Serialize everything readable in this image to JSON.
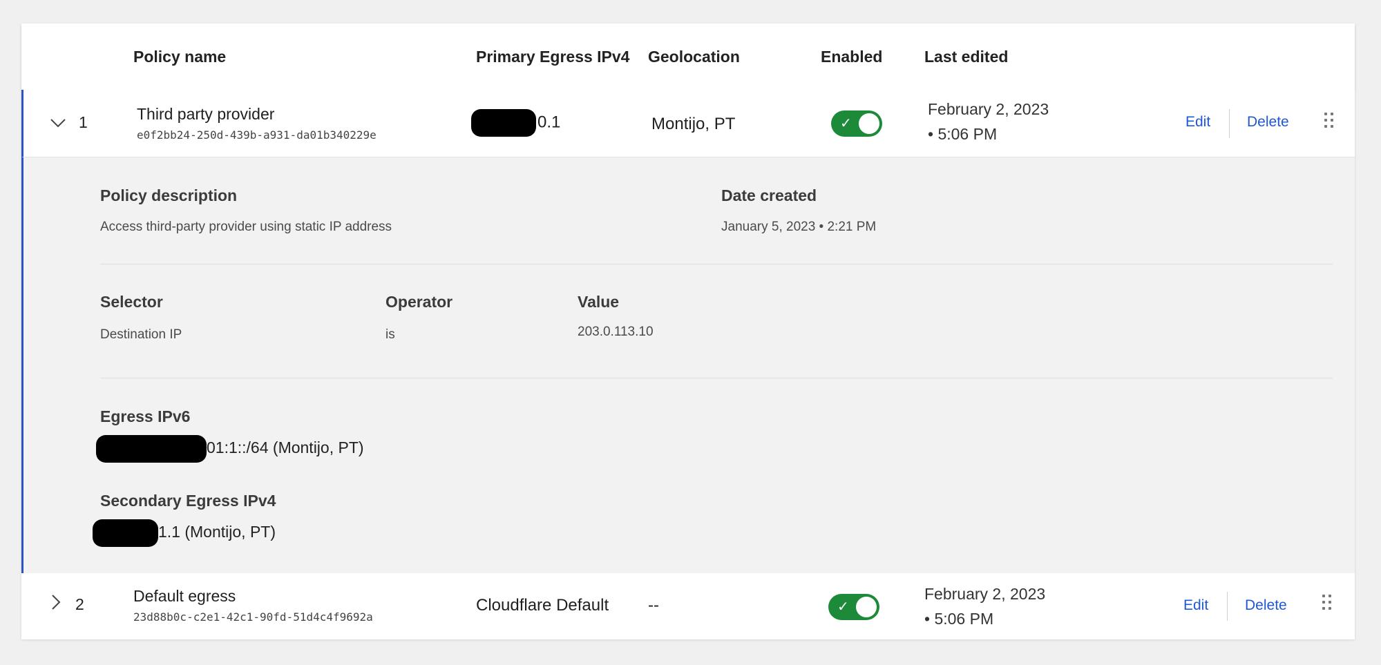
{
  "columns": {
    "policy_name": "Policy name",
    "primary_egress": "Primary Egress IPv4",
    "geolocation": "Geolocation",
    "enabled": "Enabled",
    "last_edited": "Last edited"
  },
  "rows": [
    {
      "index": "1",
      "expanded": true,
      "name": "Third party provider",
      "id": "e0f2bb24-250d-439b-a931-da01b340229e",
      "primary_egress_suffix": "0.1",
      "geolocation": "Montijo, PT",
      "enabled": true,
      "last_edited_date": "February 2, 2023",
      "last_edited_time": "• 5:06 PM",
      "edit_label": "Edit",
      "delete_label": "Delete"
    },
    {
      "index": "2",
      "expanded": false,
      "name": "Default egress",
      "id": "23d88b0c-c2e1-42c1-90fd-51d4c4f9692a",
      "primary_egress": "Cloudflare Default",
      "geolocation": "--",
      "enabled": true,
      "last_edited_date": "February 2, 2023",
      "last_edited_time": "• 5:06 PM",
      "edit_label": "Edit",
      "delete_label": "Delete"
    }
  ],
  "detail": {
    "policy_description_label": "Policy description",
    "policy_description": "Access third-party provider using static IP address",
    "date_created_label": "Date created",
    "date_created": "January 5, 2023 • 2:21 PM",
    "selector_label": "Selector",
    "selector_value": "Destination IP",
    "operator_label": "Operator",
    "operator_value": "is",
    "value_label": "Value",
    "value_value": "203.0.113.10",
    "egress_ipv6_label": "Egress IPv6",
    "egress_ipv6_suffix": "01:1::/64 (Montijo, PT)",
    "secondary_egress_label": "Secondary Egress IPv4",
    "secondary_egress_suffix": "1.1 (Montijo, PT)"
  },
  "colors": {
    "accent": "#2a53c8",
    "toggle_on": "#1d8a3a",
    "link": "#1f58d6"
  },
  "icons": {
    "expanded": "chevron-down-icon",
    "collapsed": "chevron-right-icon",
    "drag": "drag-handle-icon",
    "toggle_check": "check-icon"
  }
}
